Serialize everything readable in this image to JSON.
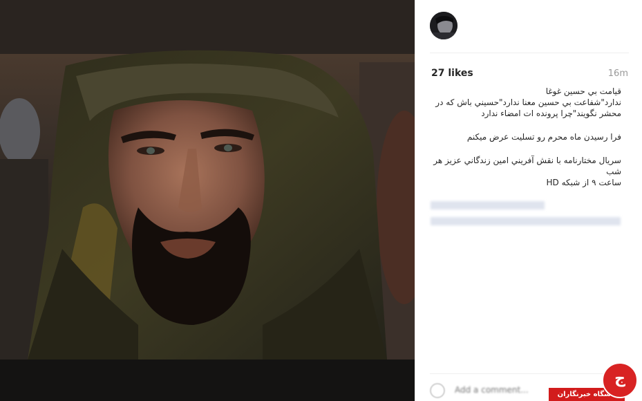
{
  "post": {
    "likes": "27 likes",
    "timestamp": "16m",
    "caption_lines": [
      "قيامت بي حسين غوغا",
      "ندارد\"شفاعت بي حسين معنا ندارد\"حسيني باش که در",
      "محشر نگويند\"چرا پرونده ات امضاء ندارد",
      "فرا رسيدن ماه محرم رو تسليت عرض ميکنم",
      "سريال مختارنامه با نقش آفريني امين زندگاني عزيز هر شب",
      "ساعت ۹ از شبکه HD"
    ]
  },
  "comment": {
    "placeholder": "Add a comment..."
  },
  "watermark": {
    "banner_text": "باشگاه خبرنگاران",
    "logo_glyph": "ج"
  },
  "colors": {
    "likes_text": "#262626",
    "timestamp_text": "#999999",
    "mention_blue": "#3f5a8a",
    "watermark_red": "#d21c1c"
  },
  "icons": [
    "avatar-image",
    "heart-icon",
    "watermark-logo"
  ]
}
